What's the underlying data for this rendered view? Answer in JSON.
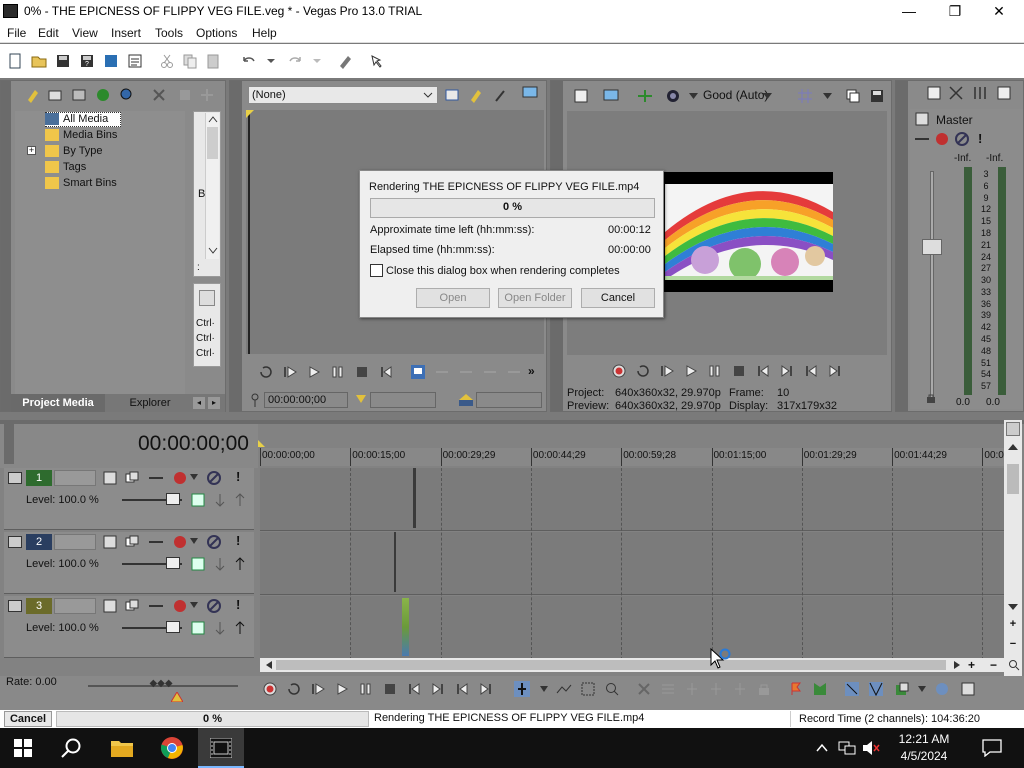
{
  "window": {
    "title": "0% - THE EPICNESS OF FLIPPY VEG FILE.veg * - Vegas Pro 13.0 TRIAL",
    "controls": [
      "—",
      "❐",
      "✕"
    ]
  },
  "menu": [
    "File",
    "Edit",
    "View",
    "Insert",
    "Tools",
    "Options",
    "Help"
  ],
  "project_media": {
    "tree": [
      {
        "label": "All Media",
        "expander": ""
      },
      {
        "label": "Media Bins",
        "expander": ""
      },
      {
        "label": "By Type",
        "expander": "+"
      },
      {
        "label": "Tags",
        "expander": ""
      },
      {
        "label": "Smart Bins",
        "expander": ""
      }
    ],
    "side_letter": "B",
    "side_sep": ":",
    "ctrl_lines": [
      "Ctrl·",
      "Ctrl·",
      "Ctrl·"
    ],
    "tabs": [
      "Project Media",
      "Explorer"
    ]
  },
  "trimmer": {
    "dropdown_value": "(None)",
    "timecode": "00:00:00;00"
  },
  "preview": {
    "quality": "Good (Auto)",
    "project_label": "Project:",
    "project_value": "640x360x32, 29.970p",
    "preview_label": "Preview:",
    "preview_value": "640x360x32, 29.970p",
    "frame_label": "Frame:",
    "frame_value": "10",
    "display_label": "Display:",
    "display_value": "317x179x32"
  },
  "master": {
    "title": "Master",
    "left_top": "-Inf.",
    "right_top": "-Inf.",
    "scale": [
      "3",
      "6",
      "9",
      "12",
      "15",
      "18",
      "21",
      "24",
      "27",
      "30",
      "33",
      "36",
      "39",
      "42",
      "45",
      "48",
      "51",
      "54",
      "57"
    ],
    "left_bottom": "0.0",
    "right_bottom": "0.0"
  },
  "timeline": {
    "timecode": "00:00:00;00",
    "ruler": [
      "00:00:00;00",
      "00:00:15;00",
      "00:00:29;29",
      "00:00:44;29",
      "00:00:59;28",
      "00:01:15;00",
      "00:01:29;29",
      "00:01:44;29",
      "00:0"
    ],
    "tracks": [
      {
        "number": "1",
        "level": "Level: 100.0 %"
      },
      {
        "number": "2",
        "level": "Level: 100.0 %"
      },
      {
        "number": "3",
        "level": "Level: 100.0 %"
      }
    ],
    "rate": "Rate: 0.00"
  },
  "dialog": {
    "title": "Rendering THE EPICNESS OF FLIPPY VEG FILE.mp4",
    "progress_text": "0 %",
    "progress": 0,
    "time_left_label": "Approximate time left (hh:mm:ss):",
    "time_left_value": "00:00:12",
    "elapsed_label": "Elapsed time (hh:mm:ss):",
    "elapsed_value": "00:00:00",
    "close_checkbox_label": "Close this dialog box when rendering completes",
    "open_label": "Open",
    "open_folder_label": "Open Folder",
    "cancel_label": "Cancel"
  },
  "statusbar": {
    "cancel_label": "Cancel",
    "progress_text": "0 %",
    "message": "Rendering THE EPICNESS OF FLIPPY VEG FILE.mp4",
    "record_time": "Record Time (2 channels): 104:36:20"
  },
  "taskbar": {
    "time": "12:21 AM",
    "date": "4/5/2024"
  }
}
